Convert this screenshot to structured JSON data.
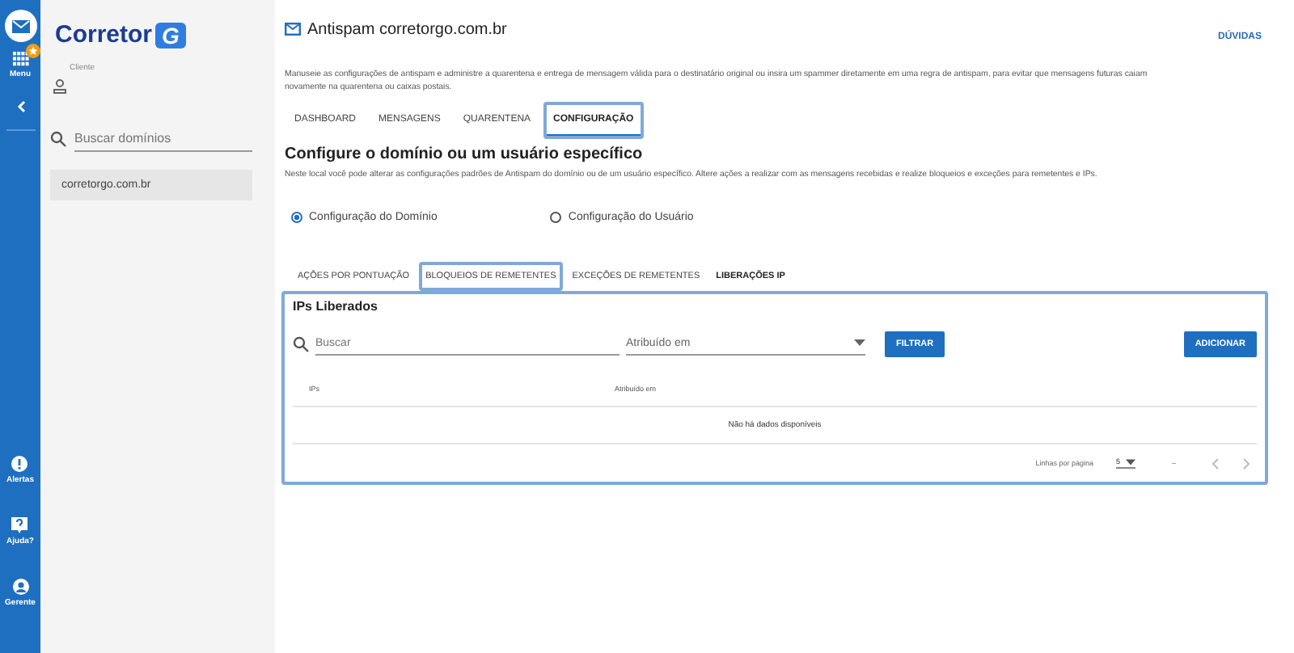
{
  "rail": {
    "items": [
      {
        "label": "Menu",
        "kind": "grid",
        "badge": true
      },
      {
        "label": "Alertas",
        "kind": "alert",
        "badge": false
      },
      {
        "label": "Ajuda?",
        "kind": "help",
        "badge": false
      },
      {
        "label": "Gerente",
        "kind": "person",
        "badge": false
      }
    ]
  },
  "sidebar": {
    "logo": "Corretor",
    "logo_mark": "G",
    "client_label": "Cliente",
    "search": {
      "placeholder": "Buscar domínios"
    },
    "domains": [
      {
        "label": "corretorgo.com.br",
        "selected": true
      }
    ]
  },
  "header": {
    "title": "Antispam corretorgo.com.br",
    "help_link": "DÚVIDAS",
    "description": "Manuseie as configurações de antispam e administre a quarentena e entrega de mensagem válida para o destinatário original ou insira um spammer diretamente em uma regra de antispam, para evitar que mensagens futuras caiam novamente na quarentena ou caixas postais."
  },
  "tabs": [
    {
      "label": "DASHBOARD",
      "selected": false,
      "highlighted": false
    },
    {
      "label": "MENSAGENS",
      "selected": false,
      "highlighted": false
    },
    {
      "label": "QUARENTENA",
      "selected": false,
      "highlighted": false
    },
    {
      "label": "CONFIGURAÇÃO",
      "selected": true,
      "highlighted": true
    }
  ],
  "section": {
    "title": "Configure o domínio ou um usuário específico",
    "description": "Neste local você pode alterar as configurações padrões de Antispam do domínio ou de um usuário específico. Altere ações a realizar com as mensagens recebidas e realize bloqueios e exceções para remetentes e IPs."
  },
  "radios": [
    {
      "label": "Configuração do Domínio",
      "selected": true
    },
    {
      "label": "Configuração do Usuário",
      "selected": false
    }
  ],
  "subtabs": [
    {
      "label": "AÇÕES POR PONTUAÇÃO",
      "selected": false,
      "highlighted": false
    },
    {
      "label": "BLOQUEIOS DE REMETENTES",
      "selected": false,
      "highlighted": true
    },
    {
      "label": "EXCEÇÕES DE REMETENTES",
      "selected": false,
      "highlighted": false
    },
    {
      "label": "LIBERAÇÕES IP",
      "selected": true,
      "highlighted": false
    }
  ],
  "panel": {
    "title": "IPs Liberados",
    "highlighted": true,
    "search": {
      "placeholder": "Buscar"
    },
    "assigned": {
      "placeholder": "Atribuído em"
    },
    "filter_button": "FILTRAR",
    "add_button": "ADICIONAR",
    "table": {
      "columns": [
        "IPs",
        "Atribuído em"
      ],
      "empty": "Não há dados disponíveis"
    },
    "pagination": {
      "rows_label": "Linhas por página",
      "rows_value": "5",
      "range": "–"
    }
  }
}
